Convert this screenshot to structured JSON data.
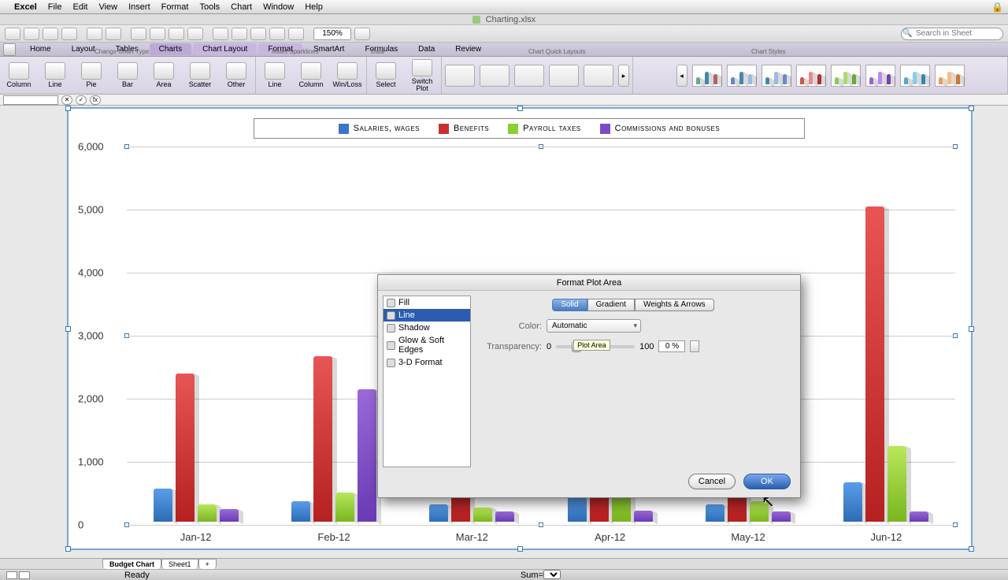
{
  "menubar": {
    "app": "Excel",
    "items": [
      "File",
      "Edit",
      "View",
      "Insert",
      "Format",
      "Tools",
      "Chart",
      "Window",
      "Help"
    ]
  },
  "window": {
    "title": "Charting.xlsx"
  },
  "toolbar": {
    "zoom": "150%",
    "search_placeholder": "Search in Sheet"
  },
  "ribbon": {
    "tabs": [
      "Home",
      "Layout",
      "Tables",
      "Charts",
      "Chart Layout",
      "Format",
      "SmartArt",
      "Formulas",
      "Data",
      "Review"
    ],
    "active_tab": "Charts",
    "groups": {
      "change_chart_type": {
        "label": "Change Chart Type",
        "buttons": [
          "Column",
          "Line",
          "Pie",
          "Bar",
          "Area",
          "Scatter",
          "Other"
        ]
      },
      "sparklines": {
        "label": "Insert Sparklines",
        "buttons": [
          "Line",
          "Column",
          "Win/Loss"
        ]
      },
      "data": {
        "label": "Data",
        "buttons": [
          "Select",
          "Switch Plot"
        ]
      },
      "quick_layouts": {
        "label": "Chart Quick Layouts"
      },
      "chart_styles": {
        "label": "Chart Styles"
      }
    }
  },
  "chart_data": {
    "type": "bar",
    "title": "",
    "xlabel": "",
    "ylabel": "",
    "ylim": [
      0,
      6000
    ],
    "yticks": [
      0,
      1000,
      2000,
      3000,
      4000,
      5000,
      6000
    ],
    "categories": [
      "Jan-12",
      "Feb-12",
      "Mar-12",
      "Apr-12",
      "May-12",
      "Jun-12"
    ],
    "series": [
      {
        "name": "Salaries, wages",
        "color": "#3a76c8",
        "values": [
          520,
          330,
          280,
          440,
          280,
          620
        ]
      },
      {
        "name": "Benefits",
        "color": "#c83030",
        "values": [
          2350,
          2620,
          2620,
          2620,
          2620,
          5000
        ]
      },
      {
        "name": "Payroll taxes",
        "color": "#8ad030",
        "values": [
          280,
          460,
          220,
          1120,
          330,
          1200
        ]
      },
      {
        "name": "Commissions and bonuses",
        "color": "#7a4ac8",
        "values": [
          200,
          2100,
          160,
          180,
          160,
          160
        ]
      }
    ]
  },
  "dialog": {
    "title": "Format Plot Area",
    "sidebar": [
      "Fill",
      "Line",
      "Shadow",
      "Glow & Soft Edges",
      "3-D Format"
    ],
    "sidebar_selected": "Line",
    "tabs": [
      "Solid",
      "Gradient",
      "Weights & Arrows"
    ],
    "tab_selected": "Solid",
    "color_label": "Color:",
    "color_value": "Automatic",
    "transparency_label": "Transparency:",
    "transparency_min": "0",
    "transparency_max": "100",
    "transparency_value": "0 %",
    "tooltip": "Plot Area",
    "cancel": "Cancel",
    "ok": "OK"
  },
  "sheet_tabs": [
    "Budget Chart",
    "Sheet1"
  ],
  "status": {
    "ready": "Ready",
    "sum_label": "Sum="
  }
}
